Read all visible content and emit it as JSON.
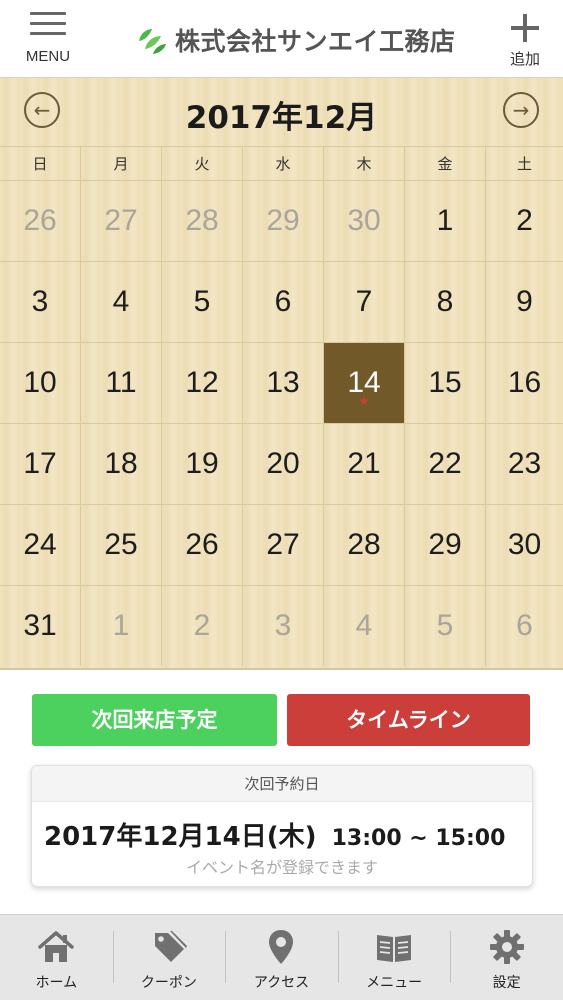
{
  "header": {
    "menu_label": "MENU",
    "brand_name": "株式会社サンエイ工務店",
    "add_label": "追加",
    "brand_color": "#4cb848"
  },
  "calendar": {
    "month_title": "2017年12月",
    "weekdays": [
      "日",
      "月",
      "火",
      "水",
      "木",
      "金",
      "土"
    ],
    "weeks": [
      [
        {
          "d": "26",
          "other": true
        },
        {
          "d": "27",
          "other": true
        },
        {
          "d": "28",
          "other": true
        },
        {
          "d": "29",
          "other": true
        },
        {
          "d": "30",
          "other": true
        },
        {
          "d": "1"
        },
        {
          "d": "2"
        }
      ],
      [
        {
          "d": "3"
        },
        {
          "d": "4"
        },
        {
          "d": "5"
        },
        {
          "d": "6"
        },
        {
          "d": "7"
        },
        {
          "d": "8"
        },
        {
          "d": "9"
        }
      ],
      [
        {
          "d": "10"
        },
        {
          "d": "11"
        },
        {
          "d": "12"
        },
        {
          "d": "13"
        },
        {
          "d": "14",
          "today": true,
          "mark": "★"
        },
        {
          "d": "15"
        },
        {
          "d": "16"
        }
      ],
      [
        {
          "d": "17"
        },
        {
          "d": "18"
        },
        {
          "d": "19"
        },
        {
          "d": "20"
        },
        {
          "d": "21"
        },
        {
          "d": "22"
        },
        {
          "d": "23"
        }
      ],
      [
        {
          "d": "24"
        },
        {
          "d": "25"
        },
        {
          "d": "26"
        },
        {
          "d": "27"
        },
        {
          "d": "28"
        },
        {
          "d": "29"
        },
        {
          "d": "30"
        }
      ],
      [
        {
          "d": "31"
        },
        {
          "d": "1",
          "other": true
        },
        {
          "d": "2",
          "other": true
        },
        {
          "d": "3",
          "other": true
        },
        {
          "d": "4",
          "other": true
        },
        {
          "d": "5",
          "other": true
        },
        {
          "d": "6",
          "other": true
        }
      ]
    ],
    "selected_color": "#72592a",
    "mark_color": "#d23c2c"
  },
  "actions": {
    "next_visit_label": "次回来店予定",
    "timeline_label": "タイムライン",
    "next_visit_color": "#4cd15e",
    "timeline_color": "#cc3e3a"
  },
  "reservation": {
    "heading": "次回予約日",
    "date": "2017年12月14日(木)",
    "time": "13:00 ~ 15:00",
    "note": "イベント名が登録できます"
  },
  "tabbar": {
    "items": [
      {
        "key": "home",
        "label": "ホーム",
        "icon": "home-icon"
      },
      {
        "key": "coupon",
        "label": "クーポン",
        "icon": "tag-icon"
      },
      {
        "key": "access",
        "label": "アクセス",
        "icon": "map-pin-icon"
      },
      {
        "key": "menu",
        "label": "メニュー",
        "icon": "book-icon"
      },
      {
        "key": "settings",
        "label": "設定",
        "icon": "gear-icon"
      }
    ]
  }
}
